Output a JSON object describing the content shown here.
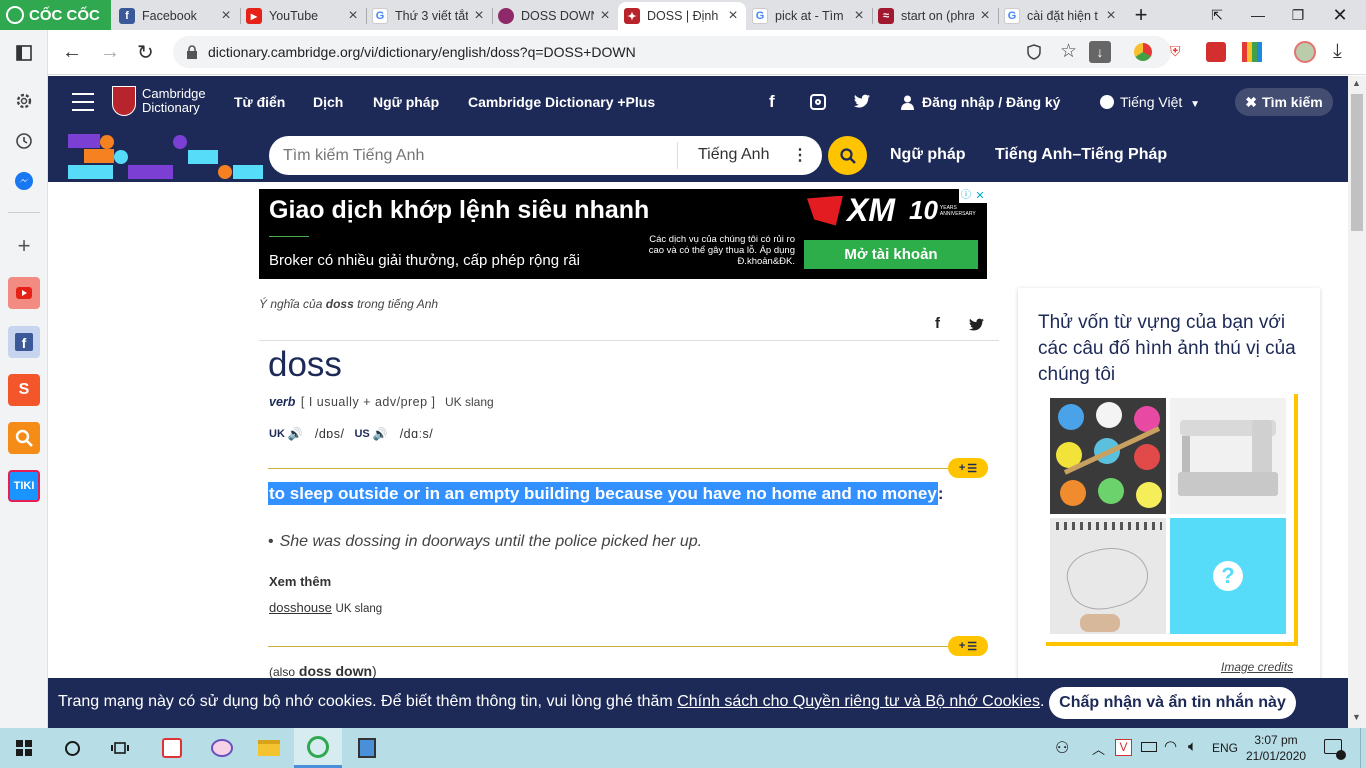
{
  "browser": {
    "brand": "CỐC CỐC",
    "tabs": [
      {
        "title": "Facebook",
        "icon": "facebook-icon"
      },
      {
        "title": "YouTube",
        "icon": "youtube-icon"
      },
      {
        "title": "Thứ 3 viết tắt",
        "icon": "google-icon"
      },
      {
        "title": "DOSS DOWN",
        "icon": "dictionary-icon"
      },
      {
        "title": "DOSS | Định",
        "icon": "cambridge-icon"
      },
      {
        "title": "pick at - Tìm",
        "icon": "google-icon"
      },
      {
        "title": "start on (phra",
        "icon": "dictionary-icon"
      },
      {
        "title": "cài đặt hiện t",
        "icon": "google-icon"
      }
    ],
    "url": "dictionary.cambridge.org/vi/dictionary/english/doss?q=DOSS+DOWN"
  },
  "header": {
    "logo_line1": "Cambridge",
    "logo_line2": "Dictionary",
    "nav": [
      "Từ điển",
      "Dịch",
      "Ngữ pháp",
      "Cambridge Dictionary +Plus"
    ],
    "login": "Đăng nhập / Đăng ký",
    "language": "Tiếng Việt",
    "search_button": "Tìm kiếm"
  },
  "search": {
    "placeholder": "Tìm kiếm Tiếng Anh",
    "dictionary": "Tiếng Anh",
    "links": [
      "Ngữ pháp",
      "Tiếng Anh–Tiếng Pháp"
    ]
  },
  "ad": {
    "headline": "Giao dịch khớp lệnh siêu nhanh",
    "sub": "Broker có nhiều giải thưởng, cấp phép rộng rãi",
    "disclaimer": "Các dịch vụ của chúng tôi có rủi ro cao và có thể gây thua lỗ. Áp dụng Đ.khoản&ĐK.",
    "brand": "XM",
    "years": "10",
    "years_label": "YEARS ANNIVERSARY",
    "cta": "Mở tài khoản"
  },
  "entry": {
    "breadcrumb_pre": "Ý nghĩa của",
    "breadcrumb_word": "doss",
    "breadcrumb_post": "trong tiếng Anh",
    "headword": "doss",
    "pos": "verb",
    "grammar": "[ I usually + adv/prep ]",
    "usage": "UK slang",
    "uk_label": "UK",
    "uk_pron": "/dɒs/",
    "us_label": "US",
    "us_pron": "/dɑːs/",
    "definition": "to sleep outside or in an empty building because you have no home and no money",
    "definition_end": ":",
    "example": "She was dossing in doorways until the police picked her up.",
    "see_also_label": "Xem thêm",
    "see_also_link": "dosshouse",
    "see_also_usage": "UK slang",
    "also_pre": "(also",
    "also_word": "doss down",
    "also_post": ")",
    "add_button": "+"
  },
  "sidebar_box": {
    "title": "Thử vốn từ vựng của bạn với các câu đố hình ảnh thú vị của chúng tôi",
    "credits": "Image credits",
    "question_mark": "?"
  },
  "cookie": {
    "text": "Trang mạng này có sử dụng bộ nhớ cookies. Để biết thêm thông tin, vui lòng ghé thăm ",
    "link": "Chính sách cho Quyền riêng tư và Bộ nhớ Cookies",
    "end": ".",
    "button": "Chấp nhận và ẩn tin nhắn này"
  },
  "taskbar": {
    "lang": "ENG",
    "time": "3:07 pm",
    "date": "21/01/2020"
  }
}
